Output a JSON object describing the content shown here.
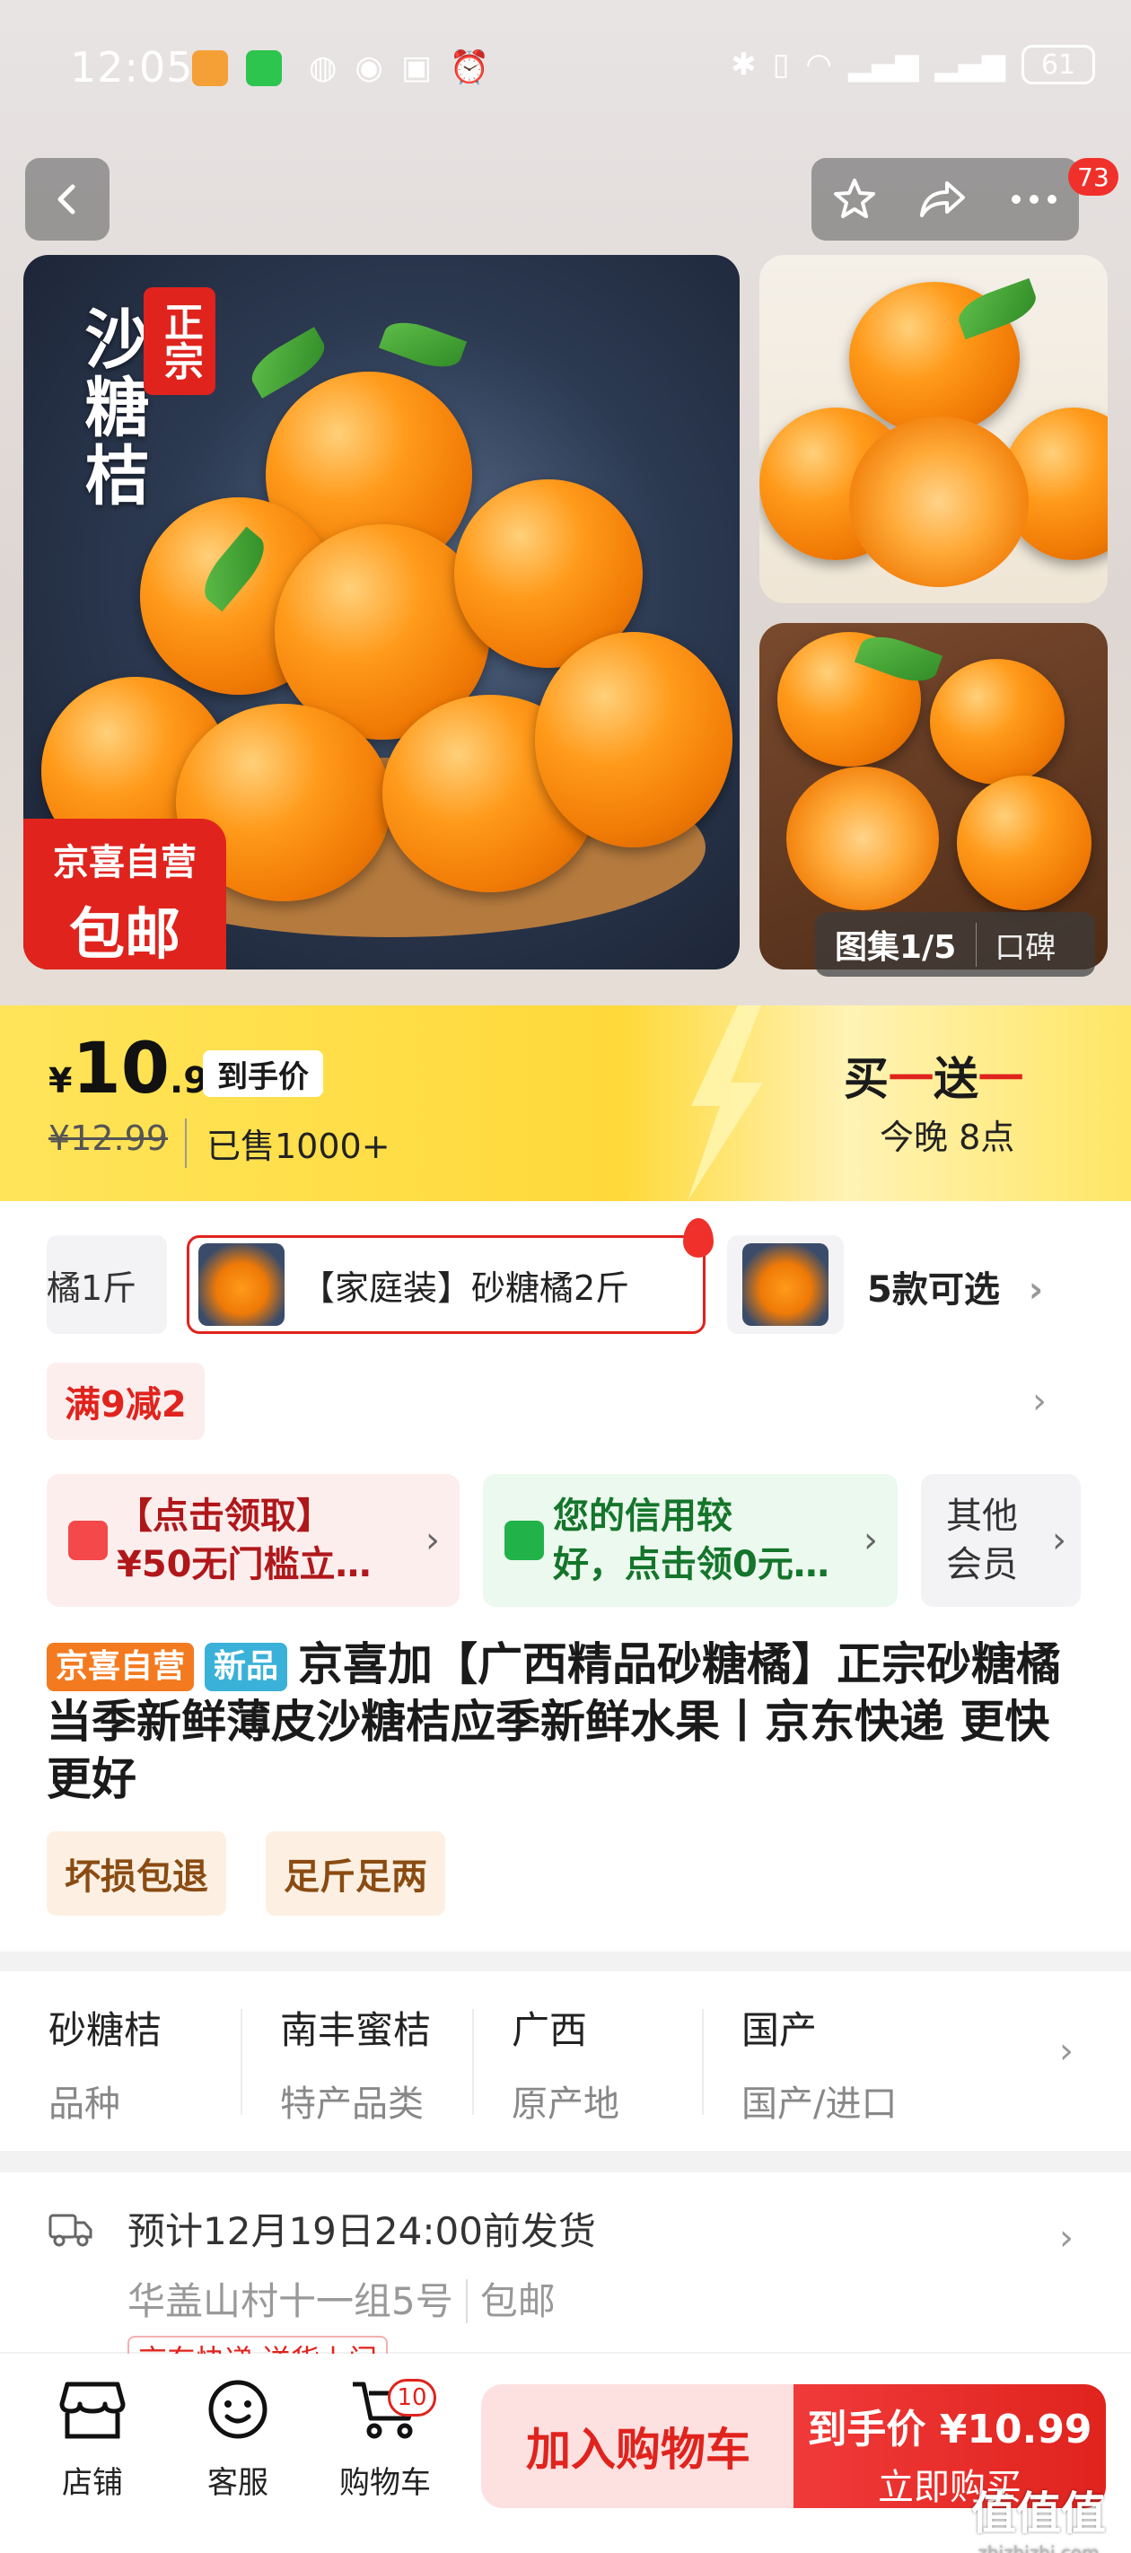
{
  "status_bar": {
    "time": "12:05",
    "battery": "61"
  },
  "nav": {
    "cart_count": "73"
  },
  "gallery": {
    "main_title": "沙糖桔",
    "main_badge": "正宗",
    "corner_line1": "京喜自营",
    "corner_line2": "包邮",
    "counter": "图集1/5",
    "review": "口碑"
  },
  "price": {
    "currency": "¥",
    "integer": "10",
    "decimal": ".99",
    "tag": "到手价",
    "original": "¥12.99",
    "sold": "已售1000+",
    "promo_pre": "买",
    "promo_dash1": "一",
    "promo_mid": "送",
    "promo_dash2": "一",
    "promo_time": "今晚 8点"
  },
  "sku": {
    "prev": "橘1斤",
    "selected": "【家庭装】砂糖橘2斤",
    "more": "5款可选"
  },
  "promo": {
    "manjian": "满9减2"
  },
  "coupons": [
    {
      "line1": "【点击领取】",
      "line2": "¥50无门槛立…"
    },
    {
      "line1": "您的信用较",
      "line2": "好，点击领0元…"
    },
    {
      "line1": "其他",
      "line2": "会员"
    }
  ],
  "title": {
    "tag1": "京喜自营",
    "tag2": "新品",
    "text": "京喜加【广西精品砂糖橘】正宗砂糖橘当季新鲜薄皮沙糖桔应季新鲜水果丨京东快递 更快更好"
  },
  "services": [
    "坏损包退",
    "足斤足两"
  ],
  "attributes": [
    {
      "value": "砂糖桔",
      "key": "品种"
    },
    {
      "value": "南丰蜜桔",
      "key": "特产品类"
    },
    {
      "value": "广西",
      "key": "原产地"
    },
    {
      "value": "国产",
      "key": "国产/进口"
    }
  ],
  "shipping": {
    "line1": "预计12月19日24:00前发货",
    "address": "华盖山村十一组5号",
    "free": "包邮",
    "tags": "京东快递  送货上门"
  },
  "bottom_bar": {
    "shop": "店铺",
    "service": "客服",
    "cart": "购物车",
    "cart_count": "10",
    "add_cart": "加入购物车",
    "buy_line1": "到手价 ¥10.99",
    "buy_line2": "立即购买"
  },
  "watermark": {
    "main": "值值值",
    "sub": "zhizhizhi.com"
  },
  "colors": {
    "accent": "#e0231d",
    "banner": "#ffdd40",
    "green": "#14752b"
  }
}
